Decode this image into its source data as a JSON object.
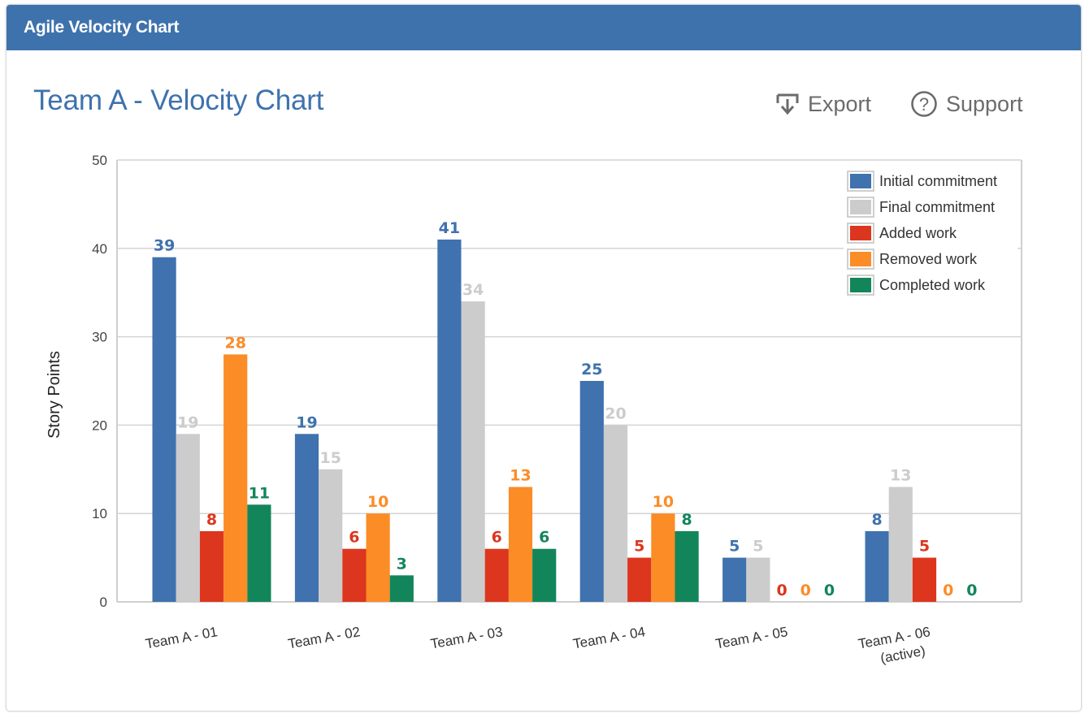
{
  "panel": {
    "title": "Agile Velocity Chart"
  },
  "header": {
    "chart_title": "Team A - Velocity Chart",
    "actions": [
      {
        "label": "Export",
        "icon": "export-icon"
      },
      {
        "label": "Support",
        "icon": "help-circle-icon"
      }
    ]
  },
  "colors": {
    "header_bg": "#3e72ad",
    "title_text": "#3e72ad",
    "action_text": "#6b6b6b",
    "grid": "#d4d4d4"
  },
  "chart_data": {
    "type": "bar",
    "title": "Team A - Velocity Chart",
    "xlabel": "",
    "ylabel": "Story Points",
    "ylim": [
      0,
      50
    ],
    "yticks": [
      0,
      10,
      20,
      30,
      40,
      50
    ],
    "grid": true,
    "legend_position": "top-right",
    "categories": [
      "Team A - 01",
      "Team A - 02",
      "Team A - 03",
      "Team A - 04",
      "Team A - 05",
      "Team A - 06\n(active)"
    ],
    "series": [
      {
        "name": "Initial commitment",
        "color": "#3f72ae",
        "values": [
          39,
          19,
          41,
          25,
          5,
          8
        ]
      },
      {
        "name": "Final commitment",
        "color": "#cccccc",
        "values": [
          19,
          15,
          34,
          20,
          5,
          13
        ]
      },
      {
        "name": "Added work",
        "color": "#dc361e",
        "values": [
          8,
          6,
          6,
          5,
          0,
          5
        ]
      },
      {
        "name": "Removed work",
        "color": "#fb8c26",
        "values": [
          28,
          10,
          13,
          10,
          0,
          0
        ]
      },
      {
        "name": "Completed work",
        "color": "#12865a",
        "values": [
          11,
          3,
          6,
          8,
          0,
          0
        ]
      }
    ]
  }
}
